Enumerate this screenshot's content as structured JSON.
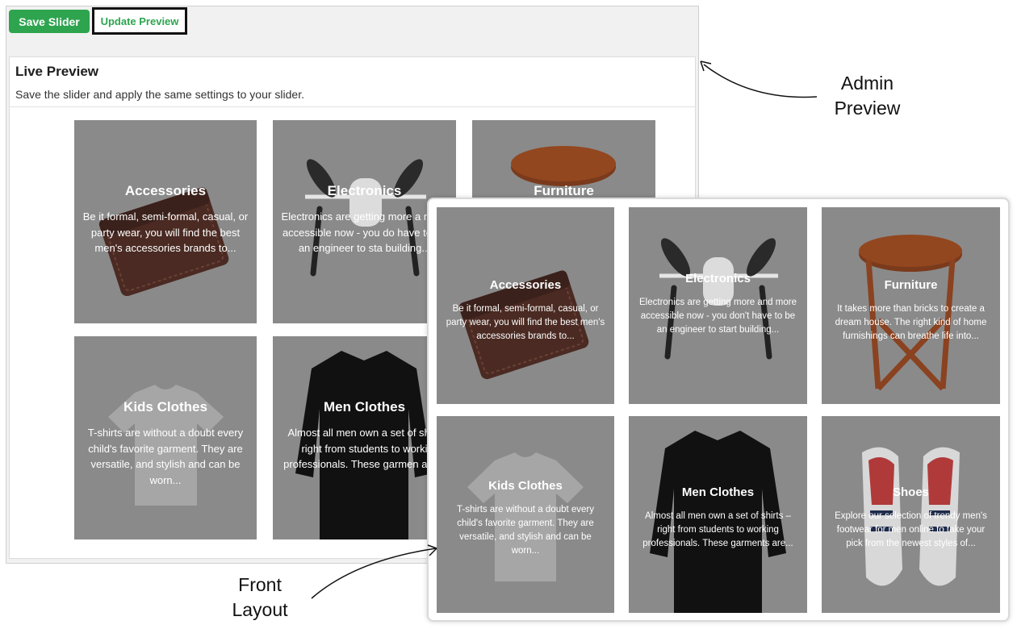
{
  "toolbar": {
    "save_label": "Save Slider",
    "update_label": "Update Preview"
  },
  "preview": {
    "title": "Live Preview",
    "subtitle": "Save the slider and apply the same settings to your slider."
  },
  "categories": [
    {
      "title": "Accessories",
      "description": "Be it formal, semi-formal, casual, or party wear, you will find the best men's accessories brands to...",
      "icon": "wallet-icon"
    },
    {
      "title": "Electronics",
      "description": "Electronics are getting more and more accessible now - you don't have to be an engineer to start building...",
      "icon": "drone-icon"
    },
    {
      "title": "Furniture",
      "description": "It takes more than bricks to create a dream house. The right kind of home furnishings can breathe life into...",
      "icon": "table-icon"
    },
    {
      "title": "Kids Clothes",
      "description": "T-shirts are without a doubt every child's favorite garment. They are versatile, and stylish and can be worn...",
      "icon": "tshirt-icon"
    },
    {
      "title": "Men Clothes",
      "description": "Almost all men own a set of shirts – right from students to working professionals. These garments are...",
      "icon": "shirt-icon"
    },
    {
      "title": "Shoes",
      "description": "Explore our selection of trendy men's footwear for men online to take your pick from the newest styles of...",
      "icon": "shoes-icon"
    }
  ],
  "admin_preview_excerpts": {
    "electronics": "Electronics are getting more a more accessible now - you do have to be an engineer to sta building...",
    "men_clothes": "Almost all men own a set of shi – right from students to worki professionals. These garmen are..."
  },
  "annotations": {
    "admin_line1": "Admin",
    "admin_line2": "Preview",
    "front_line1": "Front",
    "front_line2": "Layout"
  },
  "colors": {
    "save_button": "#2ea44f",
    "card_overlay": "#8a8a8a"
  }
}
